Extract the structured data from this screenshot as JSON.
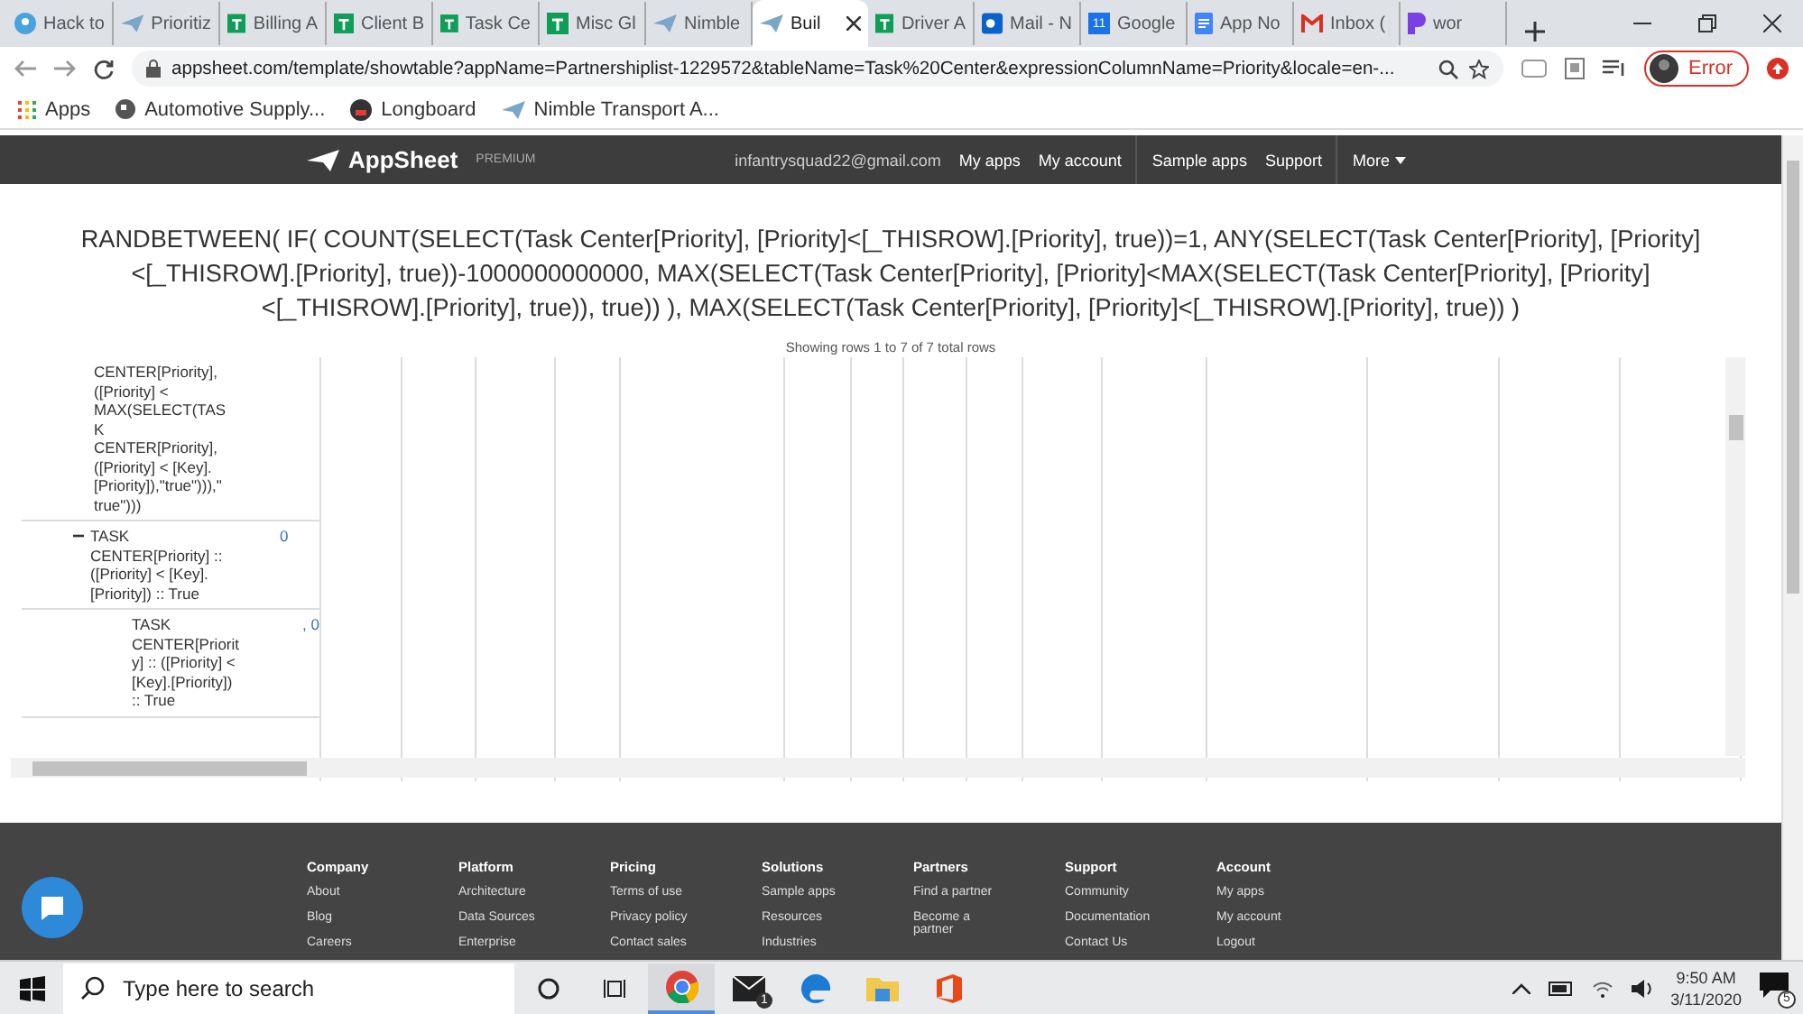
{
  "tabs": [
    {
      "label": "Hack to",
      "kind": "group",
      "selected": false
    },
    {
      "label": "Prioritiz",
      "kind": "plane",
      "selected": false
    },
    {
      "label": "Billing A",
      "kind": "sheet",
      "selected": false
    },
    {
      "label": "Client B",
      "kind": "sheet",
      "selected": false
    },
    {
      "label": "Task Ce",
      "kind": "sheet",
      "selected": false
    },
    {
      "label": "Misc Gl",
      "kind": "sheet",
      "selected": false
    },
    {
      "label": "Nimble",
      "kind": "plane",
      "selected": false
    },
    {
      "label": "Buil",
      "kind": "plane",
      "selected": true
    },
    {
      "label": "Driver A",
      "kind": "sheet",
      "selected": false
    },
    {
      "label": "Mail - N",
      "kind": "mail",
      "selected": false
    },
    {
      "label": "Google",
      "kind": "calendar",
      "badge": "11",
      "selected": false
    },
    {
      "label": "App No",
      "kind": "doc",
      "selected": false
    },
    {
      "label": "Inbox (",
      "kind": "gmail",
      "selected": false
    },
    {
      "label": "wor",
      "kind": "p",
      "selected": false
    }
  ],
  "address_bar": {
    "url": "appsheet.com/template/showtable?appName=Partnershiplist-1229572&tableName=Task%20Center&expressionColumnName=Priority&locale=en-...",
    "profile_status": "Error"
  },
  "bookmarks": [
    {
      "label": "Apps",
      "kind": "grid"
    },
    {
      "label": "Automotive Supply...",
      "kind": "globe"
    },
    {
      "label": "Longboard",
      "kind": "round"
    },
    {
      "label": "Nimble Transport A...",
      "kind": "plane"
    }
  ],
  "nav": {
    "brand": "AppSheet",
    "tier": "PREMIUM",
    "email": "infantrysquad22@gmail.com",
    "links": [
      "My apps",
      "My account"
    ],
    "links_2": [
      "Sample apps",
      "Support"
    ],
    "more": "More"
  },
  "expression": "RANDBETWEEN( IF( COUNT(SELECT(Task Center[Priority], [Priority]<[_THISROW].[Priority], true))=1, ANY(SELECT(Task Center[Priority], [Priority]<[_THISROW].[Priority], true))-1000000000000, MAX(SELECT(Task Center[Priority], [Priority]<MAX(SELECT(Task Center[Priority], [Priority]<[_THISROW].[Priority], true)), true)) ), MAX(SELECT(Task Center[Priority], [Priority]<[_THISROW].[Priority], true)) )",
  "row_count": "Showing rows 1 to 7 of 7 total rows",
  "tree": [
    {
      "text": "CENTER[Priority],\n([Priority] <\nMAX(SELECT(TAS\nK\nCENTER[Priority],\n([Priority] < [Key].\n[Priority]),\"true\"))),\"\ntrue\")))"
    },
    {
      "text": "TASK\nCENTER[Priority] ::\n([Priority] < [Key].\n[Priority]) :: True",
      "toggle": "−",
      "expanded": true,
      "value": "0",
      "children": [
        {
          "text": "TASK\nCENTER[Priorit\ny] :: ([Priority] <\n[Key].[Priority])\n:: True",
          "value": ", 0"
        }
      ]
    }
  ],
  "footer": [
    {
      "heading": "Company",
      "links": [
        "About",
        "Blog",
        "Careers"
      ]
    },
    {
      "heading": "Platform",
      "links": [
        "Architecture",
        "Data Sources",
        "Enterprise"
      ]
    },
    {
      "heading": "Pricing",
      "links": [
        "Terms of use",
        "Privacy policy",
        "Contact sales"
      ]
    },
    {
      "heading": "Solutions",
      "links": [
        "Sample apps",
        "Resources",
        "Industries"
      ]
    },
    {
      "heading": "Partners",
      "links": [
        "Find a partner",
        "Become a\npartner"
      ]
    },
    {
      "heading": "Support",
      "links": [
        "Community",
        "Documentation",
        "Contact Us"
      ]
    },
    {
      "heading": "Account",
      "links": [
        "My apps",
        "My account",
        "Logout"
      ]
    }
  ],
  "taskbar": {
    "search_placeholder": "Type here to search",
    "apps": [
      {
        "kind": "cortana"
      },
      {
        "kind": "taskview"
      },
      {
        "kind": "chrome",
        "selected": true
      },
      {
        "kind": "mail",
        "badge": "1",
        "selected": false
      },
      {
        "kind": "edge",
        "selected": false
      },
      {
        "kind": "folder",
        "selected": false
      },
      {
        "kind": "office",
        "selected": false
      }
    ],
    "time": "9:50 AM",
    "date": "3/11/2020",
    "notifications": "5"
  }
}
